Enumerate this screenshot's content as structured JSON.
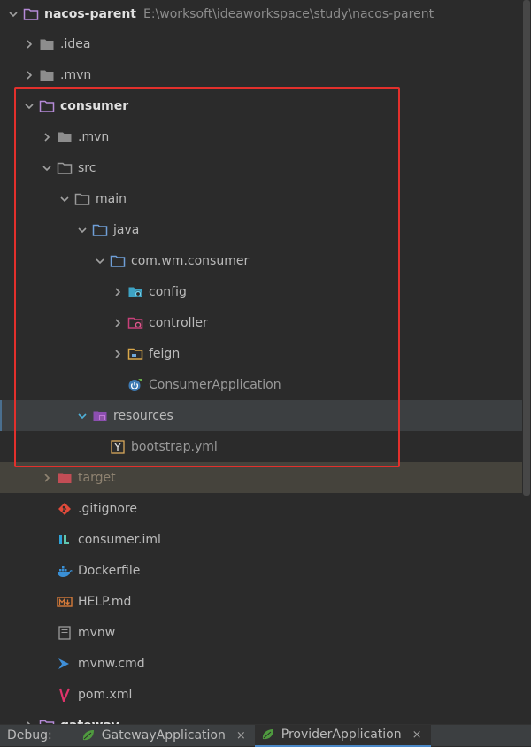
{
  "project": {
    "name": "nacos-parent",
    "path": "E:\\worksoft\\ideaworkspace\\study\\nacos-parent"
  },
  "tree": {
    "idea": ".idea",
    "mvn_root": ".mvn",
    "consumer": "consumer",
    "consumer_mvn": ".mvn",
    "src": "src",
    "main": "main",
    "java": "java",
    "package": "com.wm.consumer",
    "config": "config",
    "controller": "controller",
    "feign": "feign",
    "consumer_app": "ConsumerApplication",
    "resources": "resources",
    "bootstrap": "bootstrap.yml",
    "target": "target",
    "gitignore": ".gitignore",
    "iml": "consumer.iml",
    "dockerfile": "Dockerfile",
    "help": "HELP.md",
    "mvnw": "mvnw",
    "mvnw_cmd": "mvnw.cmd",
    "pom": "pom.xml",
    "gateway": "gateway"
  },
  "debug": {
    "label": "Debug:",
    "tabs": [
      "GatewayApplication",
      "ProviderApplication"
    ],
    "close": "×"
  },
  "colors": {
    "highlight_box": "#e2302c",
    "folder": "#8d8d8d",
    "source_folder": "#6f9fd8",
    "resource_folder": "#b058c8",
    "excluded_folder": "#d2555d"
  }
}
